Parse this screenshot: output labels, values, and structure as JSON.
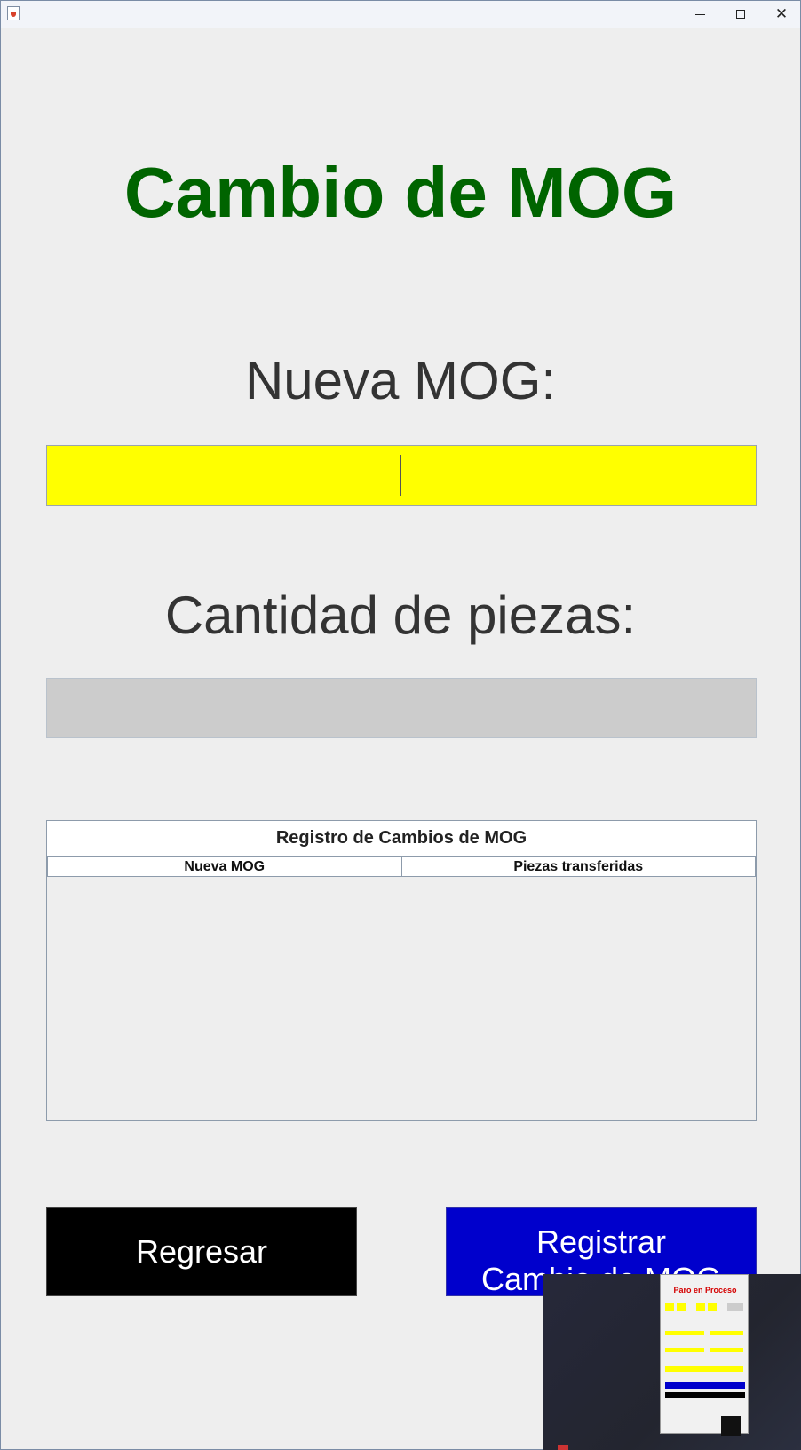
{
  "window": {
    "title": ""
  },
  "main": {
    "title": "Cambio de MOG",
    "nueva_mog_label": "Nueva MOG:",
    "nueva_mog_value": "",
    "cantidad_label": "Cantidad de piezas:",
    "cantidad_value": ""
  },
  "table": {
    "title": "Registro de Cambios de MOG",
    "columns": [
      "Nueva MOG",
      "Piezas transferidas"
    ],
    "rows": []
  },
  "buttons": {
    "back_label": "Regresar",
    "register_label": "Registrar\nCambio de MOG"
  },
  "thumbnail": {
    "title": "Paro en Proceso"
  },
  "colors": {
    "title": "#006400",
    "nueva_mog_field": "#ffff00",
    "cantidad_field": "#cccccc",
    "back_button": "#000000",
    "register_button": "#0000cc"
  },
  "icons": [
    "java-app-icon",
    "minimize-icon",
    "maximize-icon",
    "close-icon"
  ]
}
